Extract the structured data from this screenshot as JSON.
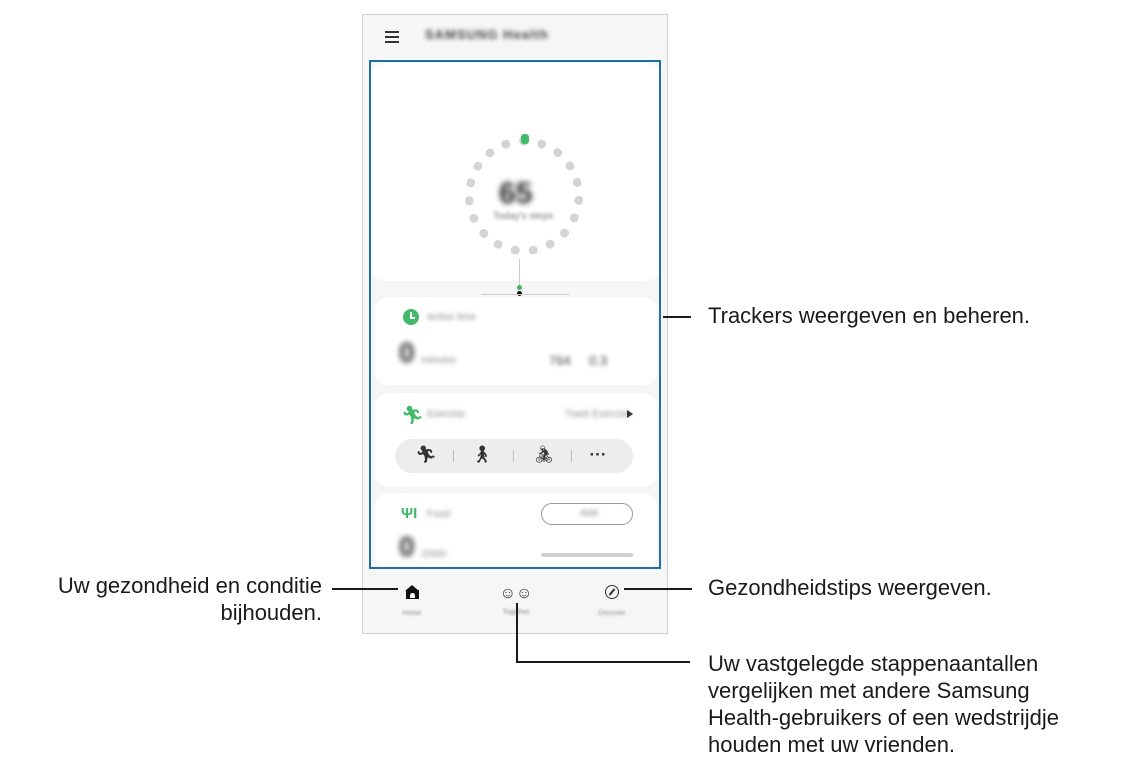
{
  "app": {
    "title": "SAMSUNG Health",
    "menu_icon": "hamburger-menu-icon"
  },
  "steps_card": {
    "value": "65",
    "caption": "Today's steps",
    "axis_start": "0",
    "axis_mid": "6000",
    "axis_end": "6000"
  },
  "active_card": {
    "icon": "clock-icon",
    "title": "Active time",
    "value": "0",
    "unit": "minutes",
    "stat_a": "764",
    "stat_b": "0.3"
  },
  "exercise_card": {
    "icon": "running-icon",
    "title": "Exercise",
    "link": "Track Exercise",
    "activities": [
      "running-icon",
      "walking-icon",
      "cycling-icon",
      "more-icon"
    ],
    "more_label": "···"
  },
  "food_card": {
    "icon": "fork-knife-icon",
    "title": "Food",
    "button_label": "Add",
    "value": "0",
    "unit": "/2000"
  },
  "bottom_nav": {
    "items": [
      {
        "label": "Home",
        "icon": "home-icon"
      },
      {
        "label": "Together",
        "icon": "people-icon",
        "glyph": "☺☺"
      },
      {
        "label": "Discover",
        "icon": "compass-icon"
      }
    ]
  },
  "callouts": {
    "trackers": "Trackers weergeven en beheren.",
    "home_line1": "Uw gezondheid en conditie",
    "home_line2": "bijhouden.",
    "tips": "Gezondheidstips weergeven.",
    "together_line1": "Uw vastgelegde stappenaantallen",
    "together_line2": "vergelijken met andere Samsung",
    "together_line3": "Health-gebruikers of een wedstrijdje",
    "together_line4": "houden met uw vrienden."
  },
  "colors": {
    "accent_green": "#43b96a",
    "highlight_blue": "#1d6fa5"
  }
}
